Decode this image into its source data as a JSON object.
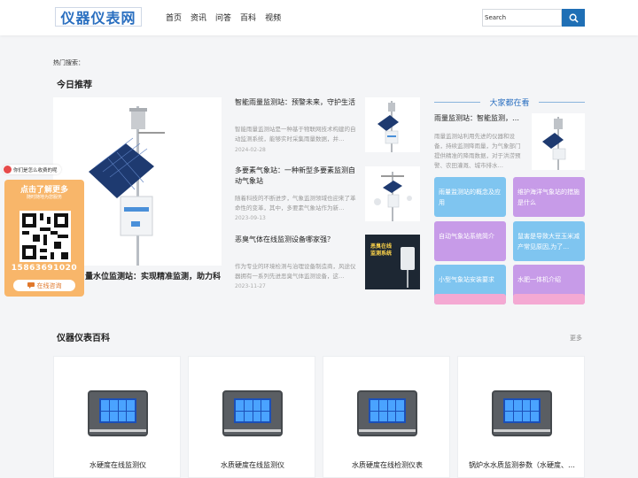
{
  "header": {
    "logo_text": "仪器仪表网",
    "nav": [
      "首页",
      "资讯",
      "问答",
      "百科",
      "视频"
    ],
    "search_value": "Search"
  },
  "hot_search_label": "热门搜索：",
  "today": {
    "title": "今日推荐",
    "featured_caption": "量水位监测站：实现精准监测，助力科",
    "articles": [
      {
        "title": "智能雨量监测站：预警未来，守护生活",
        "desc": "智能雨量监测站是一种基于物联网技术构建的自动监测系统，能够实时采集雨量数据，并…",
        "date": "2024-02-28"
      },
      {
        "title": "多要素气象站：一种新型多要素监测自动气象站",
        "desc": "随着科技的不断进步，气象监测领域也迎来了革命性的变革，其中，多要素气象站作为新…",
        "date": "2023-09-13"
      },
      {
        "title": "恶臭气体在线监测设备哪家强？",
        "desc": "作为专业的环境检测与治理设备制造商，风途仪器拥有一系列先进恶臭气体监测设备，这…",
        "date": "2023-11-27"
      }
    ],
    "thumb3_lines": [
      "恶臭在线",
      "监测系统"
    ]
  },
  "sidebar": {
    "title": "大家都在看",
    "top_title": "雨量监测站：智能监测，…",
    "top_desc": "雨量监测站利用先进的仪器和设备，持续监测降雨量，为气象部门提供精准的降雨数据，对于洪涝预警、农田灌溉、城市排水…",
    "tiles": [
      {
        "text": "雨量监测站的概念及应用",
        "color": "#7fc5f0"
      },
      {
        "text": "维护海洋气象站的措施是什么",
        "color": "#c79be8"
      },
      {
        "text": "自动气象站系统简介",
        "color": "#c79be8"
      },
      {
        "text": "鼠害是导致大豆玉米减产常见原因,为了…",
        "color": "#7fc5f0"
      },
      {
        "text": "小型气象站安装要求",
        "color": "#7fc5f0"
      },
      {
        "text": "水肥一体机介绍",
        "color": "#c79be8"
      },
      {
        "text": "",
        "color": "#f4a9d3"
      },
      {
        "text": "",
        "color": "#f4a9d3"
      }
    ]
  },
  "floating": {
    "question": "你们是怎么收费的呢",
    "cta": "点击了解更多",
    "cta_sub": "随时随地为您服务",
    "phone": "15863691020",
    "button": "在线咨询"
  },
  "encyclopedia": {
    "title": "仪器仪表百科",
    "more": "更多",
    "cards": [
      {
        "title": "水硬度在线监测仪"
      },
      {
        "title": "水质硬度在线监测仪"
      },
      {
        "title": "水质硬度在线检测仪表"
      },
      {
        "title": "锅炉水水质监测参数（水硬度、…"
      }
    ]
  },
  "colors": {
    "brand": "#1f6fb5",
    "accent_blue": "#7fc5f0",
    "accent_purple": "#c79be8",
    "accent_pink": "#f4a9d3",
    "float_orange": "#f8b66a"
  }
}
